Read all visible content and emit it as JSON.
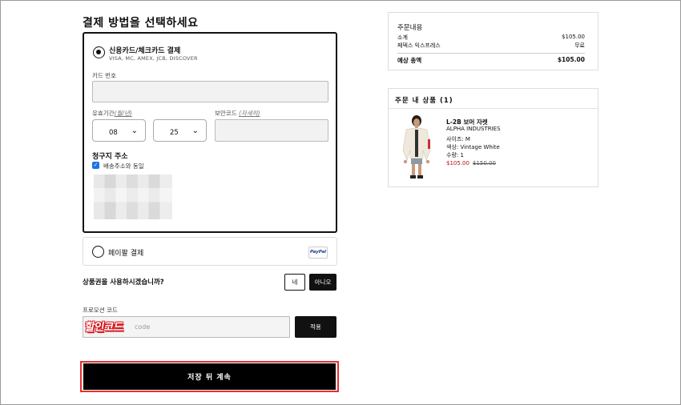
{
  "checkout": {
    "heading": "결제 방법을 선택하세요",
    "card_option": {
      "title": "신용카드/체크카드 결제",
      "networks": "VISA, MC, AMEX, JCB, DISCOVER",
      "card_number_label": "카드 번호",
      "expiry_label": "유효기간",
      "expiry_hint": "(월/년)",
      "expiry_month": "08",
      "expiry_year": "25",
      "cvv_label": "보안코드",
      "cvv_hint": "(자세히)",
      "billing_heading": "청구지 주소",
      "same_as_shipping_label": "배송주소와 동일",
      "same_as_shipping_checked": true
    },
    "paypal_option": {
      "title": "페이팔 결제",
      "badge": "PayPal"
    },
    "gift_card": {
      "question": "상품권을 사용하시겠습니까?",
      "yes_label": "네",
      "no_label": "아니오"
    },
    "promo": {
      "label": "프로모션 코드",
      "sticker_text": "할인코드",
      "placeholder": "code",
      "apply_label": "적용"
    },
    "save_continue_label": "저장 뒤 계속"
  },
  "order_summary": {
    "title": "주문내용",
    "subtotal_label": "소계",
    "subtotal_value": "$105.00",
    "shipping_label": "페덱스 익스프레스",
    "shipping_value": "무료",
    "total_label": "예상 총액",
    "total_value": "$105.00"
  },
  "order_items": {
    "title": "주문 내 상품 (1)",
    "items": [
      {
        "name": "L-2B 보머 자켓",
        "brand": "ALPHA INDUSTRIES",
        "size": "사이즈: M",
        "color": "색상: Vintage White",
        "qty": "수량: 1",
        "price": "$105.00",
        "original_price": "$150.00"
      }
    ]
  }
}
